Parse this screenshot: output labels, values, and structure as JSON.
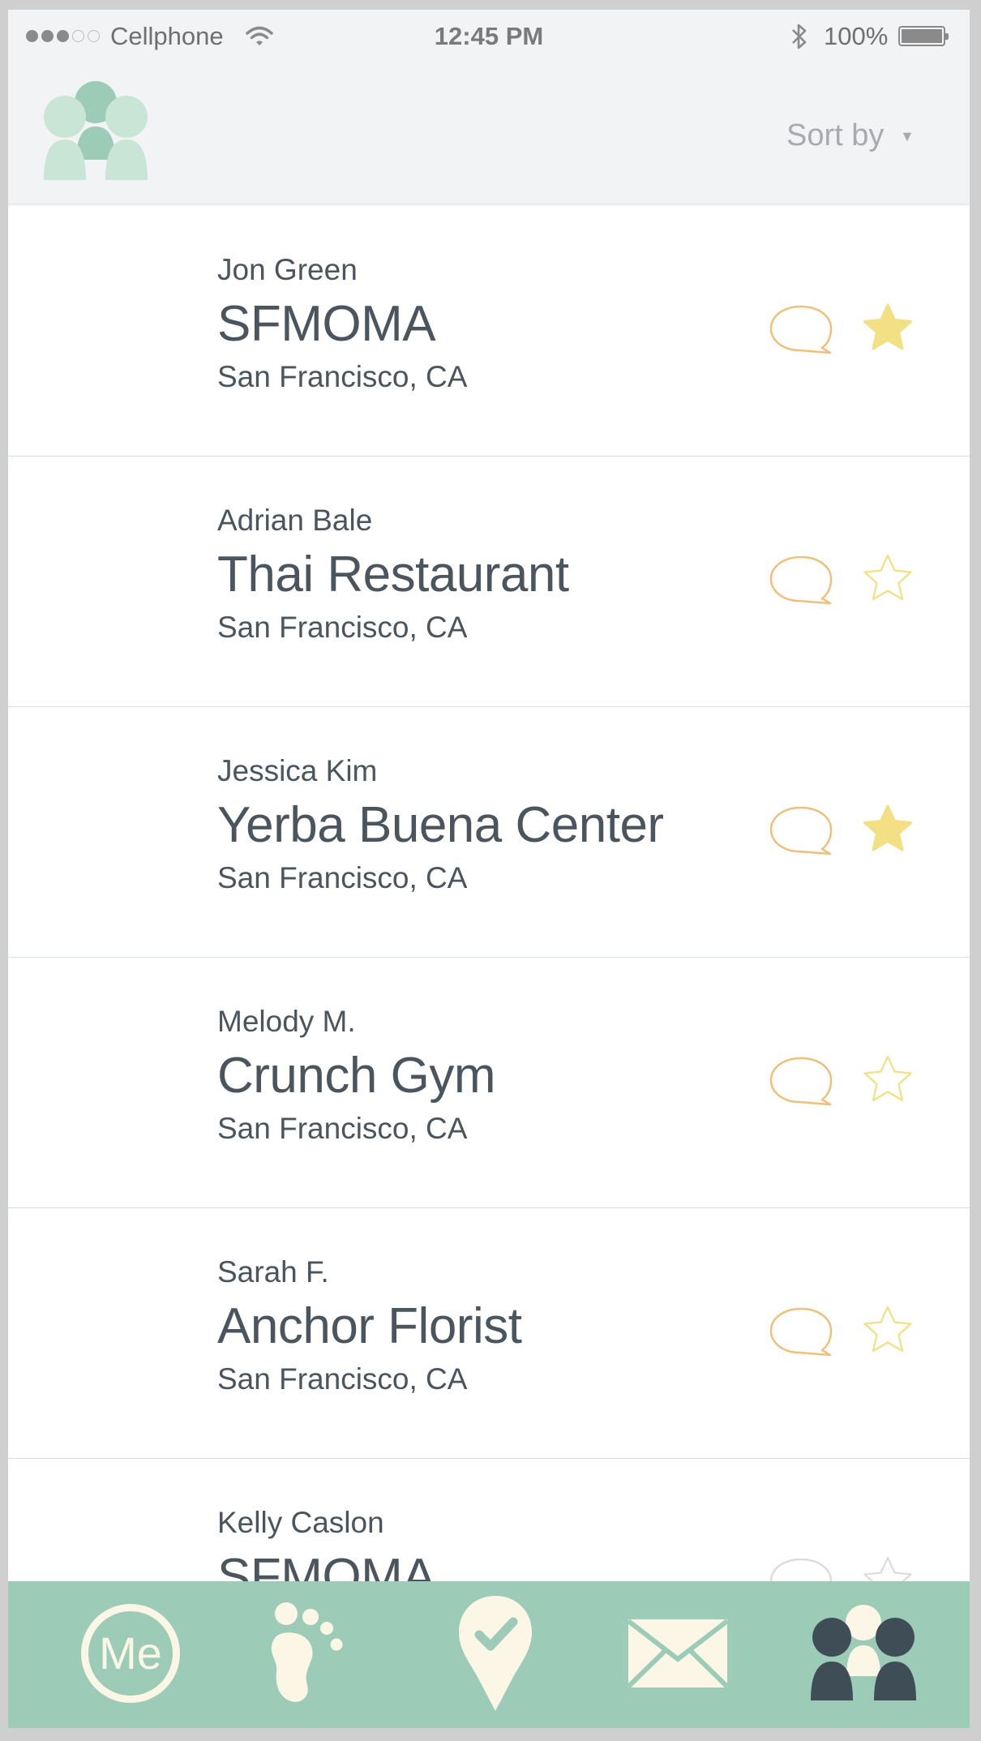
{
  "status_bar": {
    "carrier": "Cellphone",
    "time": "12:45 PM",
    "battery": "100%",
    "signal_bars_filled": 3,
    "signal_bars_total": 5
  },
  "header": {
    "sort_label": "Sort by"
  },
  "rows": [
    {
      "person": "Jon Green",
      "place": "SFMOMA",
      "city": "San Francisco, CA",
      "starred": true
    },
    {
      "person": "Adrian Bale",
      "place": "Thai Restaurant",
      "city": "San Francisco, CA",
      "starred": false
    },
    {
      "person": "Jessica Kim",
      "place": "Yerba Buena Center",
      "city": "San Francisco, CA",
      "starred": true
    },
    {
      "person": "Melody M.",
      "place": "Crunch Gym",
      "city": "San Francisco, CA",
      "starred": false
    },
    {
      "person": "Sarah F.",
      "place": "Anchor Florist",
      "city": "San Francisco, CA",
      "starred": false
    },
    {
      "person": "Kelly Caslon",
      "place": "SFMOMA",
      "city": "",
      "starred": false
    }
  ],
  "tabs": {
    "me_label": "Me",
    "icons": [
      "me-icon",
      "footprints-icon",
      "checkin-pin-icon",
      "mail-icon",
      "people-icon"
    ],
    "active": "people-icon"
  },
  "colors": {
    "accent": "#9ccbb7",
    "text": "#4a555e",
    "comment": "#f0c07a",
    "star": "#f3df84",
    "tab_icon": "#fbf6e6",
    "tab_icon_active": "#3f4e56"
  }
}
